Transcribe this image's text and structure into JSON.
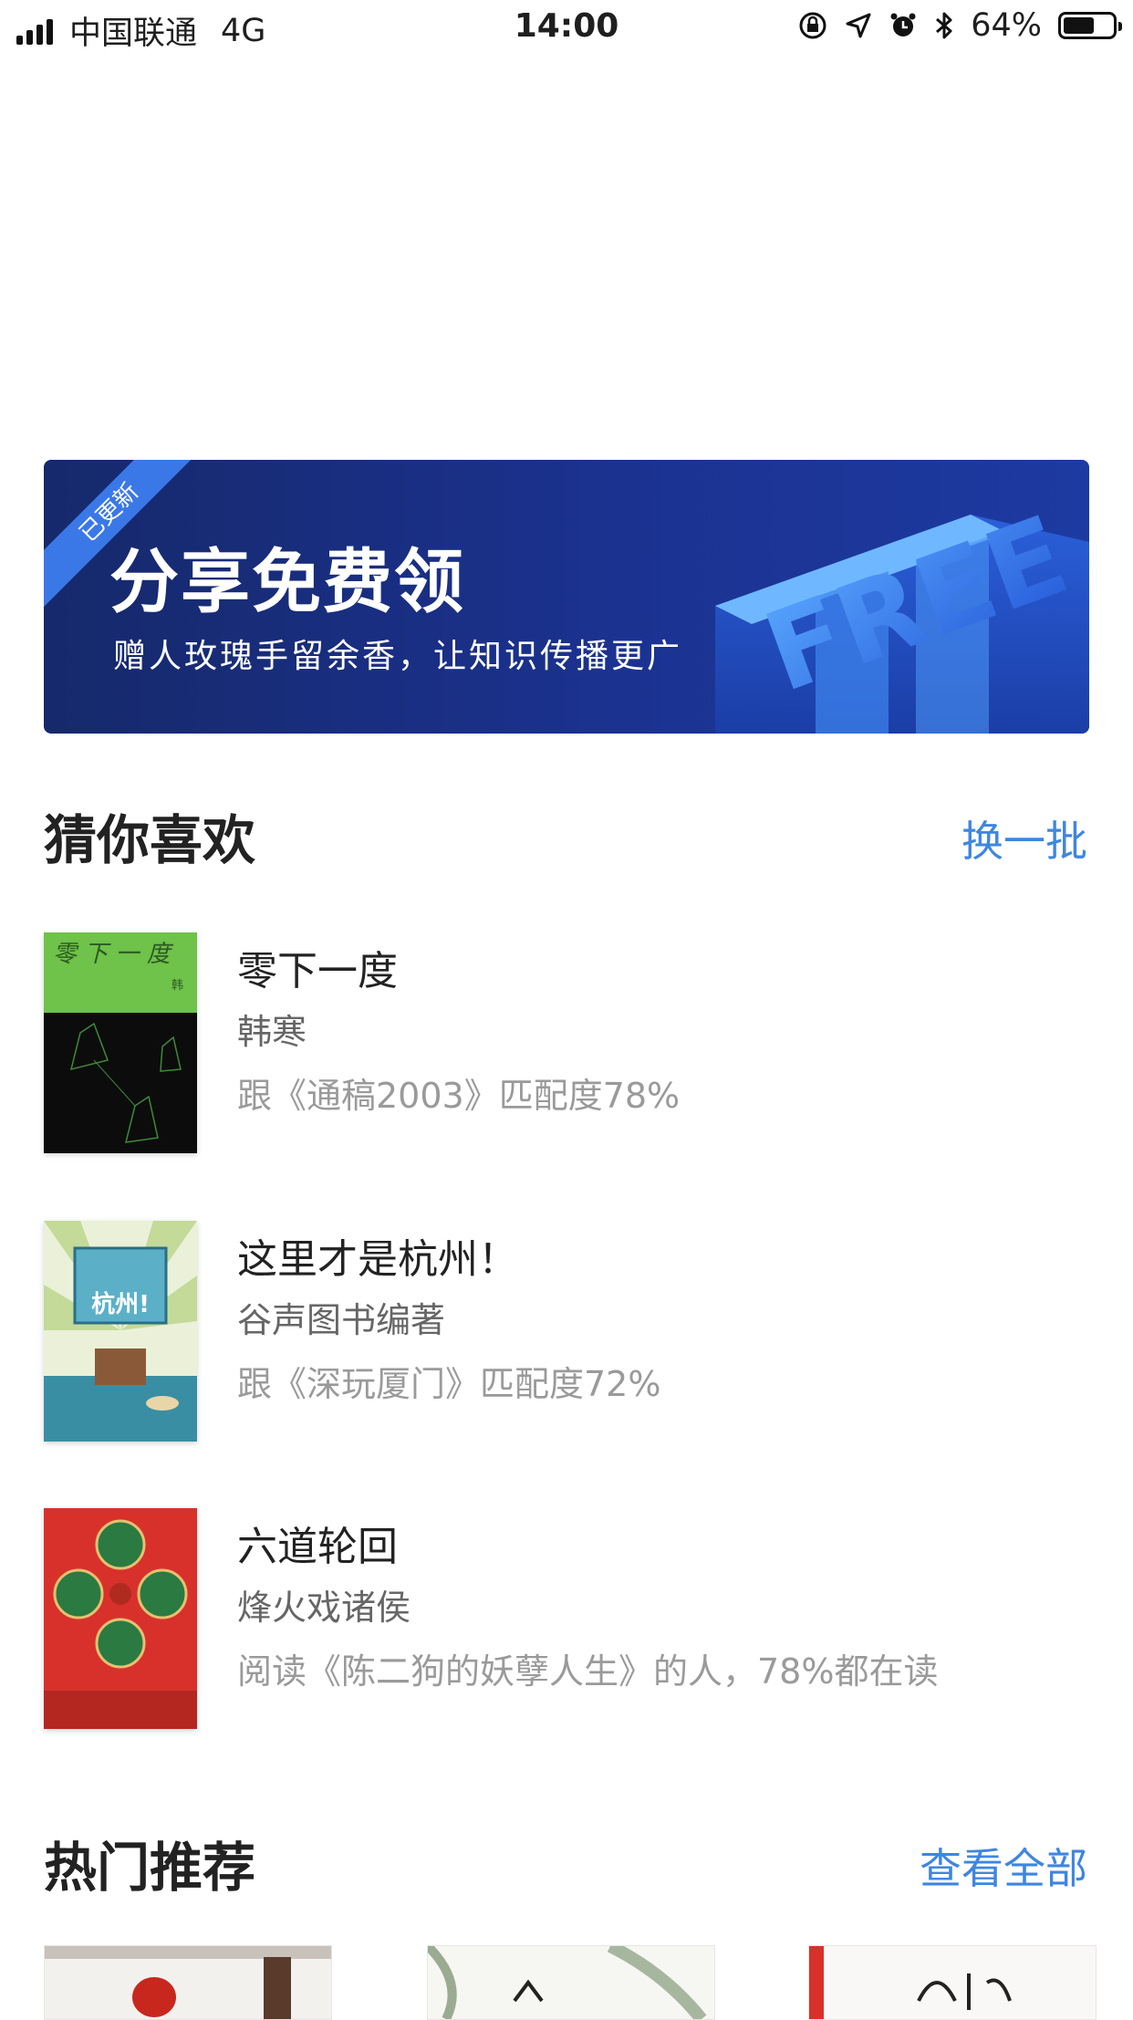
{
  "status_bar": {
    "carrier": "中国联通",
    "network": "4G",
    "time": "14:00",
    "battery": "64%",
    "battery_level": 0.64,
    "icons": [
      "orientation-lock-icon",
      "location-icon",
      "alarm-icon",
      "bluetooth-icon"
    ]
  },
  "banner": {
    "ribbon": "已更新",
    "title": "分享免费领",
    "subtitle": "赠人玫瑰手留余香，让知识传播更广",
    "art_text": "FREE"
  },
  "guess": {
    "title": "猜你喜欢",
    "action": "换一批",
    "books": [
      {
        "title": "零下一度",
        "author": "韩寒",
        "reason": "跟《通稿2003》匹配度78%"
      },
      {
        "title": "这里才是杭州！",
        "author": "谷声图书编著",
        "reason": "跟《深玩厦门》匹配度72%"
      },
      {
        "title": "六道轮回",
        "author": "烽火戏诸侯",
        "reason": "阅读《陈二狗的妖孽人生》的人，78%都在读"
      }
    ]
  },
  "hot": {
    "title": "热门推荐",
    "action": "查看全部"
  },
  "colors": {
    "accent": "#3e86e0",
    "banner_dark": "#16296b",
    "banner_ribbon": "#3a78e8"
  }
}
